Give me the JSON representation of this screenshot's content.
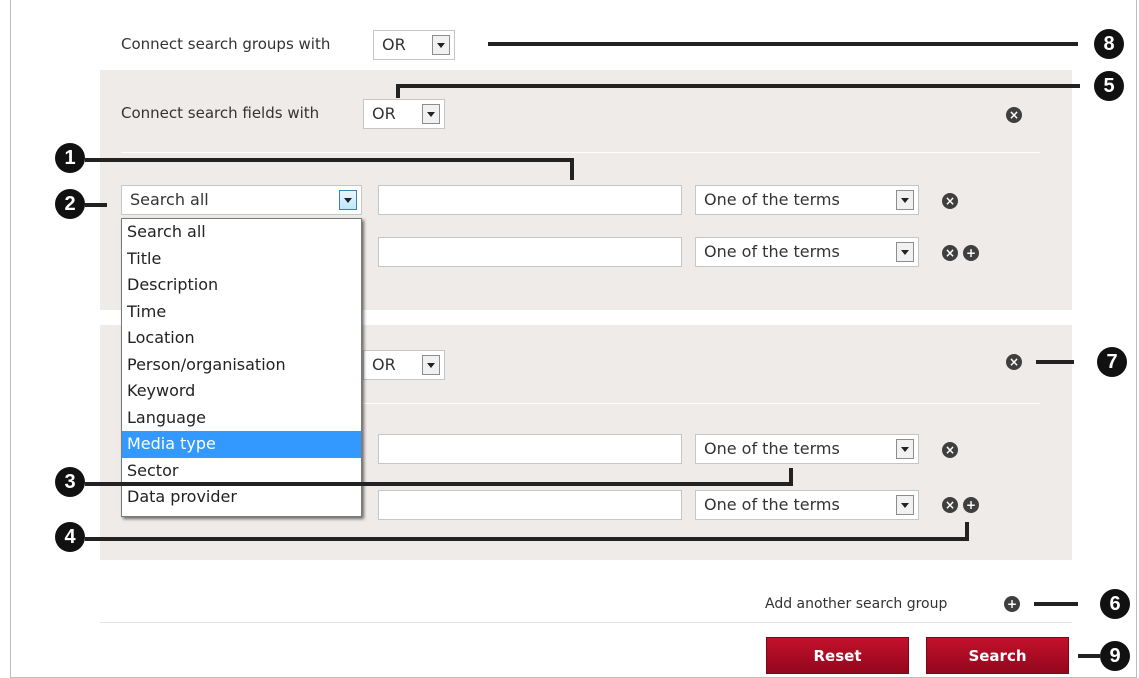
{
  "connect_groups": {
    "label": "Connect search groups with",
    "value": "OR"
  },
  "group1": {
    "connect_label": "Connect search fields with",
    "connect_value": "OR",
    "row1": {
      "field": "Search all",
      "match": "One of the terms"
    },
    "row2": {
      "match": "One of the terms"
    }
  },
  "group2": {
    "connect_value": "OR",
    "row1": {
      "match": "One of the terms"
    },
    "row2": {
      "match": "One of the terms"
    }
  },
  "dropdown_options": [
    "Search all",
    "Title",
    "Description",
    "Time",
    "Location",
    "Person/organisation",
    "Keyword",
    "Language",
    "Media type",
    "Sector",
    "Data provider"
  ],
  "dropdown_selected": "Media type",
  "add_group_label": "Add another search group",
  "buttons": {
    "reset": "Reset",
    "search": "Search"
  },
  "callouts": [
    "1",
    "2",
    "3",
    "4",
    "5",
    "6",
    "7",
    "8",
    "9"
  ],
  "icons": {
    "remove": "x-circle-icon",
    "add": "plus-circle-icon"
  },
  "colors": {
    "button": "#b00d25",
    "panel": "#efebe9",
    "highlight": "#3399ff",
    "callout": "#111111"
  }
}
